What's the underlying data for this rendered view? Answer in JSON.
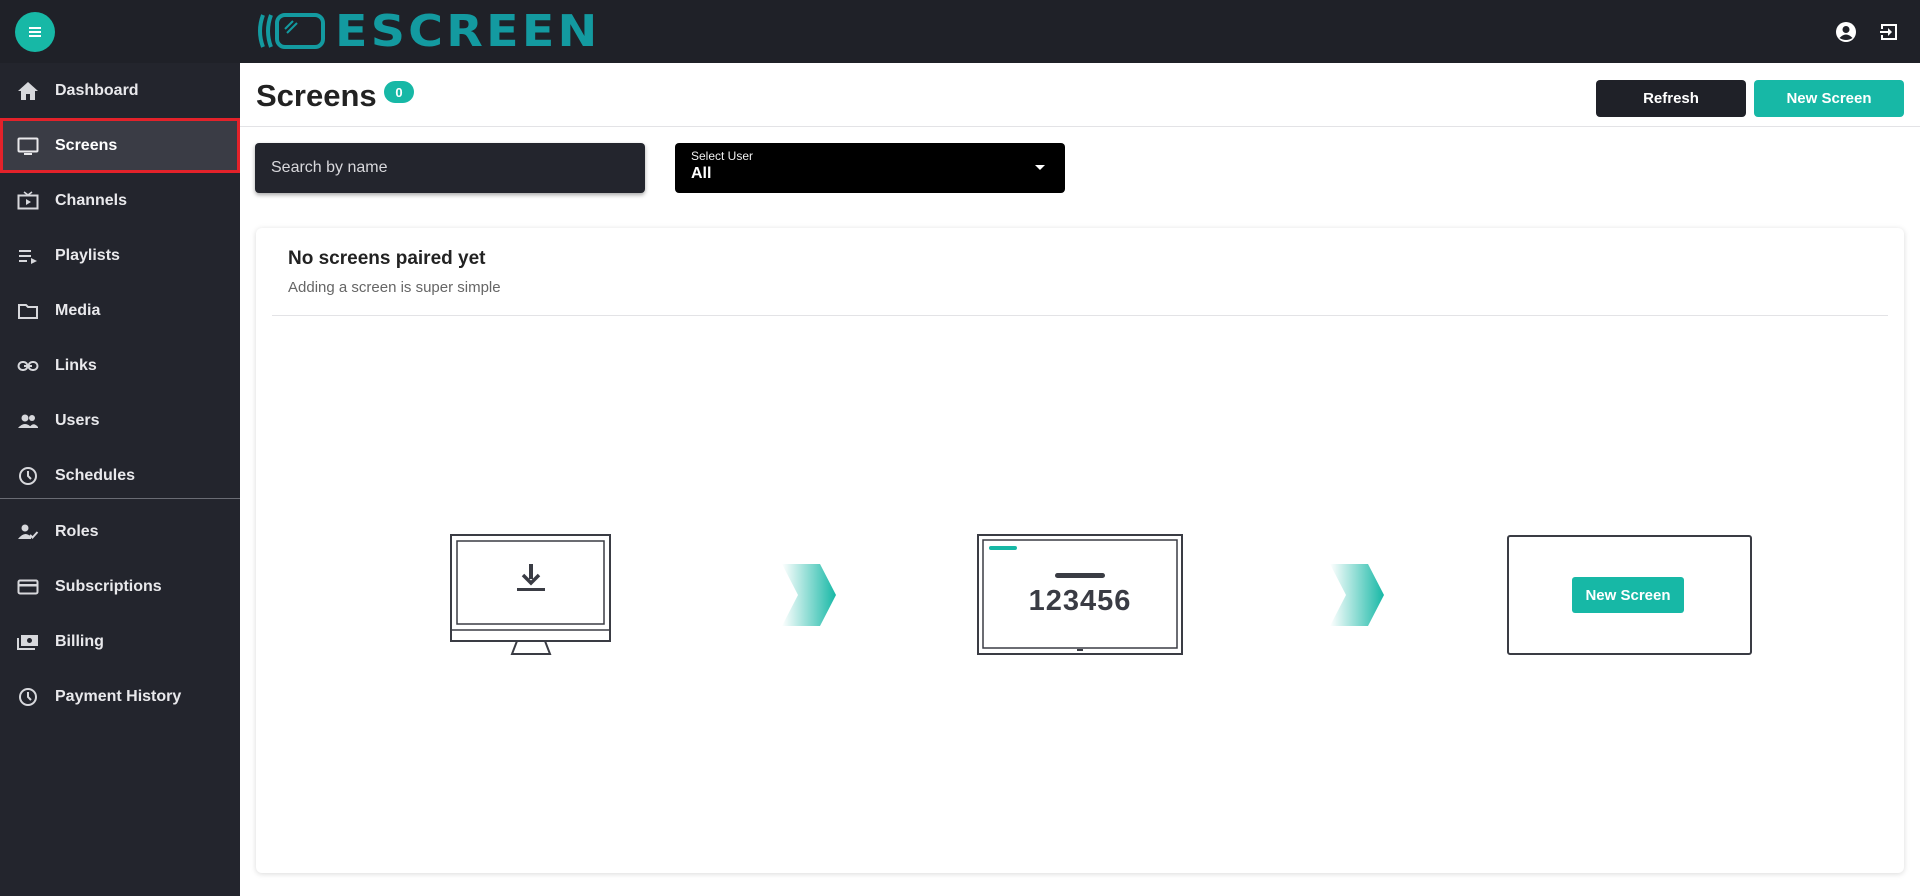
{
  "app": {
    "logo_text": "ESCREEN",
    "accent_color": "#17b8a6",
    "dark_color": "#1f2128"
  },
  "topbar": {
    "icons": [
      "menu-icon",
      "account-circle-icon",
      "logout-icon"
    ]
  },
  "sidebar": {
    "items": [
      {
        "label": "Dashboard",
        "icon": "home-icon"
      },
      {
        "label": "Screens",
        "icon": "monitor-icon",
        "active": true
      },
      {
        "label": "Channels",
        "icon": "tv-play-icon"
      },
      {
        "label": "Playlists",
        "icon": "playlist-icon"
      },
      {
        "label": "Media",
        "icon": "folder-icon"
      },
      {
        "label": "Links",
        "icon": "link-icon"
      },
      {
        "label": "Users",
        "icon": "users-icon"
      },
      {
        "label": "Schedules",
        "icon": "clock-icon"
      },
      {
        "label": "Roles",
        "icon": "user-check-icon"
      },
      {
        "label": "Subscriptions",
        "icon": "credit-card-icon"
      },
      {
        "label": "Billing",
        "icon": "billing-icon"
      },
      {
        "label": "Payment History",
        "icon": "history-clock-icon"
      }
    ]
  },
  "header": {
    "title": "Screens",
    "count": "0",
    "refresh_label": "Refresh",
    "new_screen_label": "New Screen"
  },
  "filters": {
    "search_placeholder": "Search by name",
    "select_label": "Select User",
    "select_value": "All"
  },
  "empty_state": {
    "title": "No screens paired yet",
    "subtitle": "Adding a screen is super simple",
    "pairing_code": "123456",
    "step3_button": "New Screen",
    "steps": [
      "download-monitor-icon",
      "pairing-code-screen",
      "new-screen-panel"
    ]
  }
}
